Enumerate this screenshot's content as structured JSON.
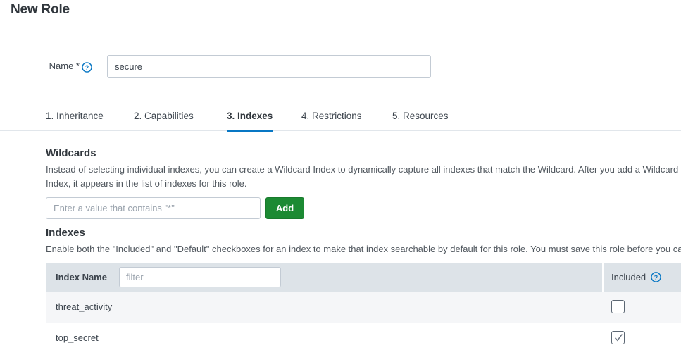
{
  "header": {
    "title": "New Role"
  },
  "name_field": {
    "label": "Name *",
    "value": "secure",
    "help_icon": "help-circle-icon"
  },
  "tabs": [
    {
      "label": "1. Inheritance",
      "active": false
    },
    {
      "label": "2. Capabilities",
      "active": false
    },
    {
      "label": "3. Indexes",
      "active": true
    },
    {
      "label": "4. Restrictions",
      "active": false
    },
    {
      "label": "5. Resources",
      "active": false
    }
  ],
  "wildcards": {
    "title": "Wildcards",
    "description": "Instead of selecting individual indexes, you can create a Wildcard Index to dynamically capture all indexes that match the Wildcard. After you add a Wildcard Index, it appears in the list of indexes for this role.",
    "input_placeholder": "Enter a value that contains \"*\"",
    "input_value": "",
    "add_label": "Add"
  },
  "indexes": {
    "title": "Indexes",
    "description": "Enable both the \"Included\" and \"Default\" checkboxes for an index to make that index searchable by default for this role. You must save this role before you can edit the indexes.",
    "table": {
      "columns": {
        "index_name": "Index Name",
        "included": "Included"
      },
      "filter_placeholder": "filter",
      "filter_value": "",
      "included_help_icon": "help-circle-icon",
      "rows": [
        {
          "name": "threat_activity",
          "included": false
        },
        {
          "name": "top_secret",
          "included": true
        }
      ]
    }
  },
  "colors": {
    "accent_blue": "#0877c4",
    "add_green": "#1c8a33",
    "header_bg": "#dde3e8",
    "row_alt_bg": "#f5f6f8",
    "text": "#3c444d"
  }
}
